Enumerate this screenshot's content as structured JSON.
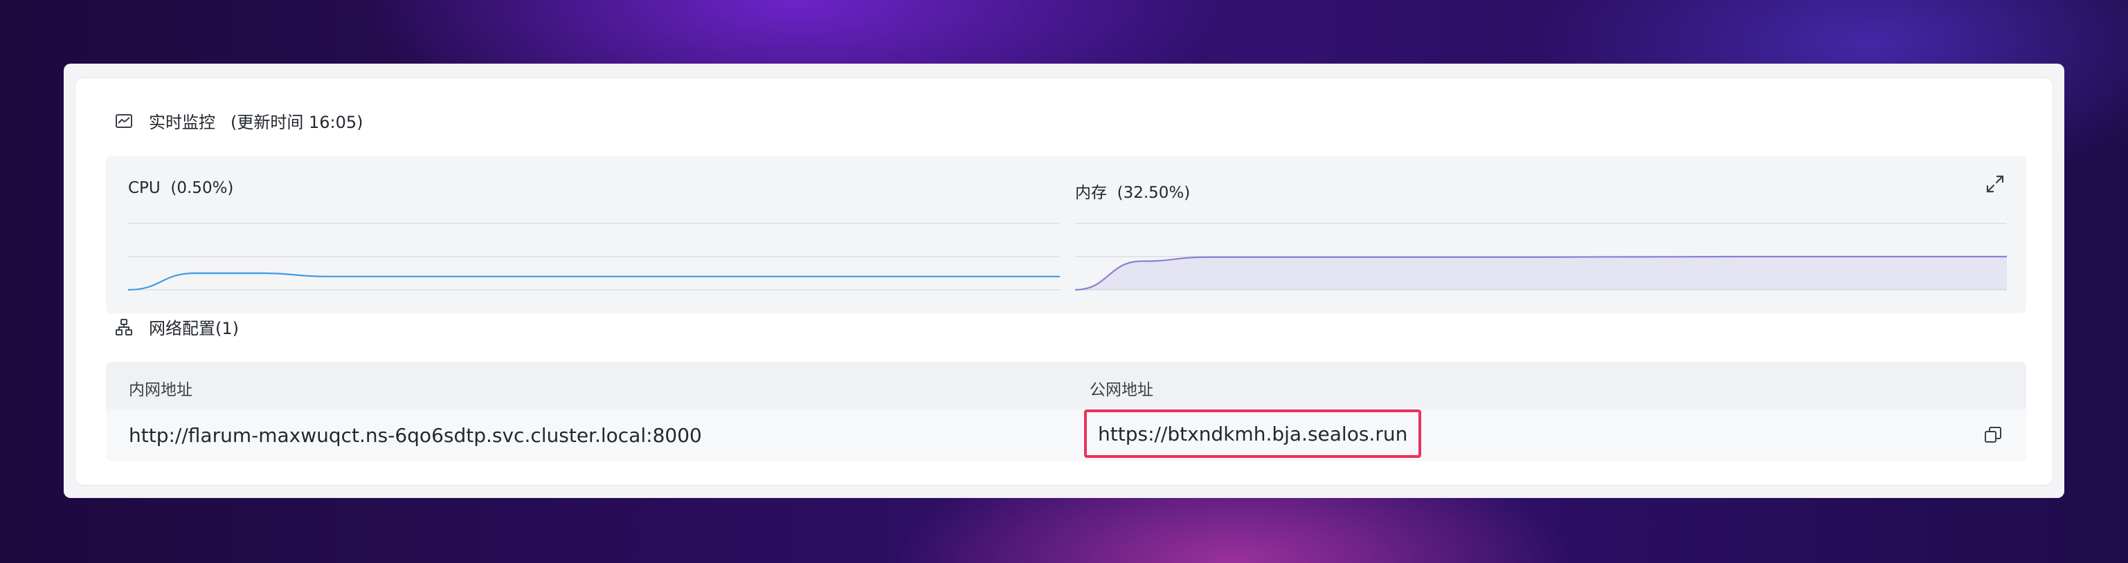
{
  "monitor": {
    "title": "实时监控",
    "updated": "(更新时间  16:05)",
    "cpu": {
      "label": "CPU",
      "value": "(0.50%)"
    },
    "memory": {
      "label": "内存",
      "value": "(32.50%)"
    },
    "expand_icon": "expand-icon",
    "monitor_icon": "monitor-icon"
  },
  "chart_data": [
    {
      "type": "line",
      "series": [
        {
          "values": [
            0.0,
            0.5,
            0.5,
            0.4,
            0.4,
            0.4,
            0.4,
            0.4,
            0.4,
            0.4,
            0.4,
            0.4,
            0.4,
            0.4,
            0.4
          ]
        }
      ],
      "ylim": [
        0,
        2
      ],
      "grid": true,
      "colors": [
        "#3b9be8"
      ]
    },
    {
      "type": "area",
      "series": [
        {
          "values": [
            0,
            28,
            32,
            32,
            32,
            32,
            32,
            32,
            32.2,
            32.3,
            32.5,
            32.5,
            32.5,
            32.5,
            32.5
          ]
        }
      ],
      "ylim": [
        0,
        65
      ],
      "grid": true,
      "colors": [
        "#8c7fd6"
      ]
    }
  ],
  "network": {
    "title": "网络配置(1)",
    "icon": "network-icon",
    "columns": {
      "internal": "内网地址",
      "public": "公网地址"
    },
    "rows": [
      {
        "internal": "http://flarum-maxwuqct.ns-6qo6sdtp.svc.cluster.local:8000",
        "public": "https://btxndkmh.bja.sealos.run"
      }
    ],
    "copy_icon": "copy-icon",
    "highlight_color": "#e8335c"
  }
}
